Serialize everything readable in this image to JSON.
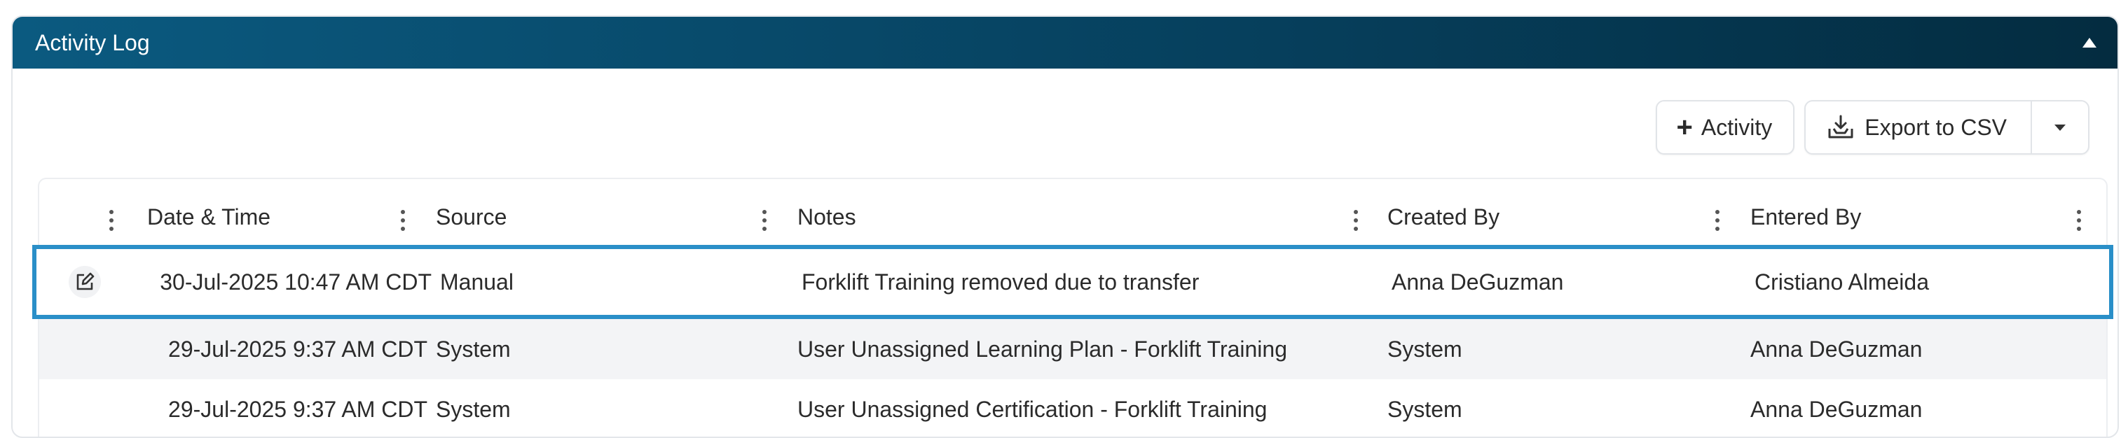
{
  "panel": {
    "title": "Activity Log"
  },
  "toolbar": {
    "add_activity_label": "Activity",
    "export_label": "Export to CSV"
  },
  "table": {
    "columns": [
      "Date & Time",
      "Source",
      "Notes",
      "Created By",
      "Entered By"
    ],
    "rows": [
      {
        "date_time": "30-Jul-2025 10:47 AM CDT",
        "source": "Manual",
        "notes": "Forklift Training removed due to transfer",
        "created_by": "Anna DeGuzman",
        "entered_by": "Cristiano Almeida",
        "selected": true,
        "editable": true
      },
      {
        "date_time": "29-Jul-2025 9:37 AM CDT",
        "source": "System",
        "notes": "User Unassigned Learning Plan - Forklift Training",
        "created_by": "System",
        "entered_by": "Anna DeGuzman"
      },
      {
        "date_time": "29-Jul-2025 9:37 AM CDT",
        "source": "System",
        "notes": "User Unassigned Certification - Forklift Training",
        "created_by": "System",
        "entered_by": "Anna DeGuzman"
      }
    ]
  },
  "colors": {
    "header_start": "#0b5a80",
    "header_end": "#042c40",
    "selection_border": "#2a8fc8"
  },
  "icons": {
    "collapse": "triangle-up-icon",
    "add": "plus-icon",
    "export": "download-tray-icon",
    "dropdown": "caret-down-icon",
    "edit": "edit-icon",
    "column_menu": "kebab-icon"
  }
}
